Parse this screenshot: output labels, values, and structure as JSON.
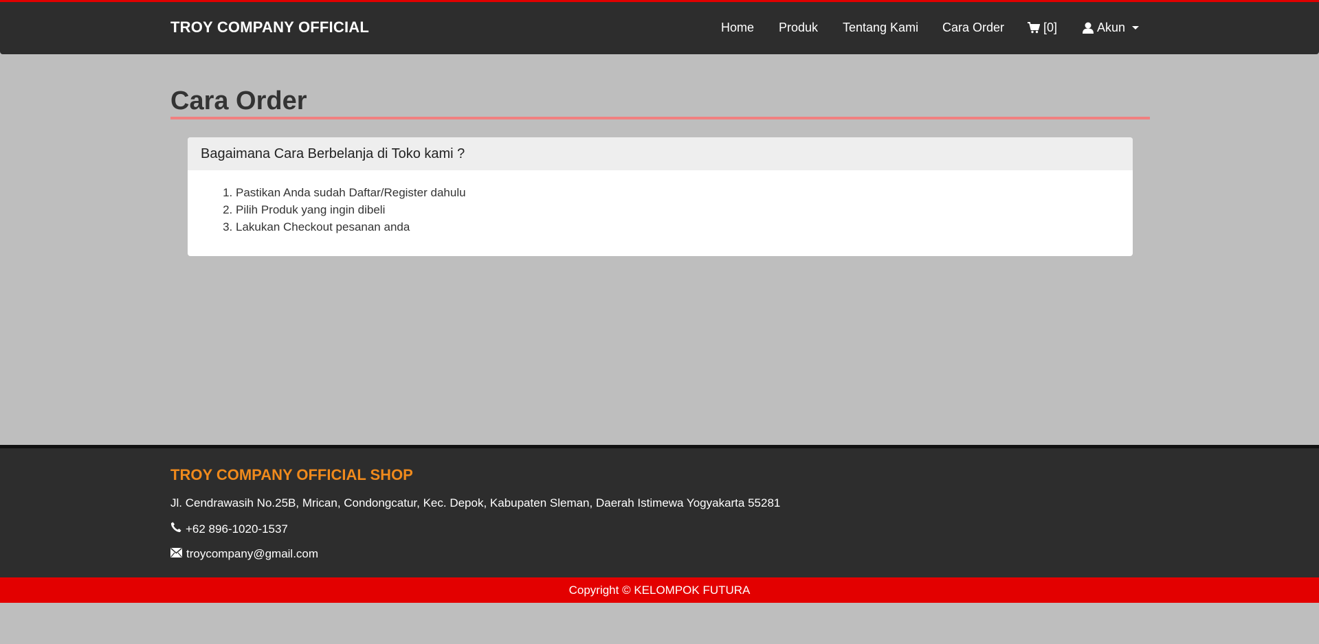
{
  "navbar": {
    "brand": "TROY COMPANY OFFICIAL",
    "links": {
      "home": "Home",
      "produk": "Produk",
      "tentang": "Tentang Kami",
      "cara_order": "Cara Order",
      "cart": "[0]",
      "akun": "Akun"
    }
  },
  "main": {
    "title": "Cara Order",
    "panel": {
      "heading": "Bagaimana Cara Berbelanja di Toko kami ?",
      "steps": [
        "Pastikan Anda sudah Daftar/Register dahulu",
        "Pilih Produk yang ingin dibeli",
        "Lakukan Checkout pesanan anda"
      ]
    }
  },
  "footer": {
    "shop_name": "TROY COMPANY OFFICIAL SHOP",
    "address": "Jl. Cendrawasih No.25B, Mrican, Condongcatur, Kec. Depok, Kabupaten Sleman, Daerah Istimewa Yogyakarta 55281",
    "phone": "+62 896-1020-1537",
    "email": "troycompany@gmail.com",
    "copyright": "Copyright © KELOMPOK FUTURA"
  },
  "colors": {
    "navbar_bg": "#2d2d2d",
    "accent_red": "#e30000",
    "title_rule": "#f08080",
    "footer_title": "#f08a1c",
    "page_bg": "#bebebe"
  },
  "icons": {
    "cart": "shopping-cart-icon",
    "user": "user-icon",
    "phone": "phone-icon",
    "email": "envelope-icon"
  }
}
